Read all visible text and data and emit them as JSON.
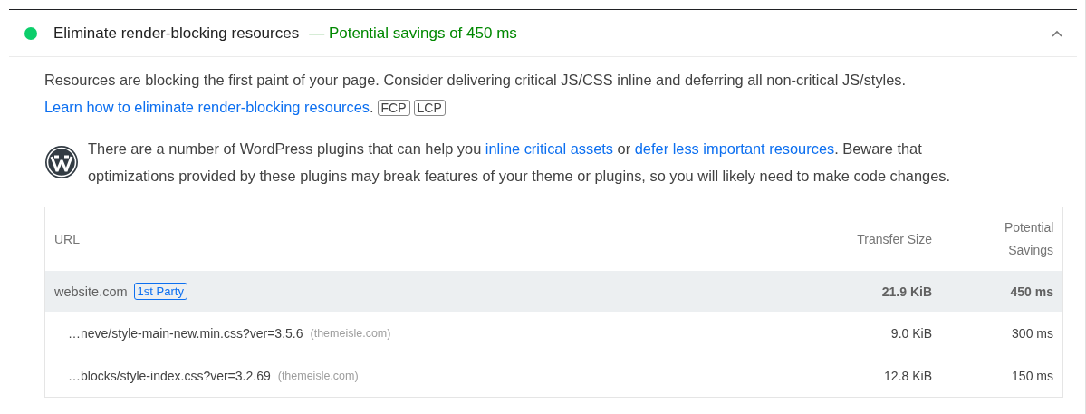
{
  "audit": {
    "title": "Eliminate render-blocking resources",
    "savings": "— Potential savings of 450 ms",
    "color": "#0cce6b",
    "expanded": true
  },
  "description": [
    {
      "kind": "text",
      "text": "Resources are blocking the first paint of your page. Consider delivering critical JS/CSS inline and deferring all non-critical JS/styles. "
    },
    {
      "kind": "link",
      "text": "Learn how to eliminate render-blocking resources"
    },
    {
      "kind": "text",
      "text": "."
    }
  ],
  "metrics": [
    "FCP",
    "LCP"
  ],
  "stack_note": [
    {
      "kind": "text",
      "text": "There are a number of WordPress plugins that can help you "
    },
    {
      "kind": "link",
      "text": "inline critical assets"
    },
    {
      "kind": "text",
      "text": " or "
    },
    {
      "kind": "link",
      "text": "defer less important resources"
    },
    {
      "kind": "text",
      "text": ". Beware that optimizations provided by these plugins may break features of your theme or plugins, so you will likely need to make code changes."
    }
  ],
  "table": {
    "columns": [
      "URL",
      "Transfer Size",
      "Potential Savings"
    ],
    "rows": [
      {
        "kind": "group",
        "url": "website.com",
        "badge": "1st Party",
        "size": "21.9 KiB",
        "savings": "450 ms"
      },
      {
        "kind": "item",
        "url": "…neve/style-main-new.min.css?ver=3.5.6",
        "host": "(themeisle.com)",
        "size": "9.0 KiB",
        "savings": "300 ms"
      },
      {
        "kind": "item",
        "url": "…blocks/style-index.css?ver=3.2.69",
        "host": "(themeisle.com)",
        "size": "12.8 KiB",
        "savings": "150 ms"
      }
    ]
  }
}
